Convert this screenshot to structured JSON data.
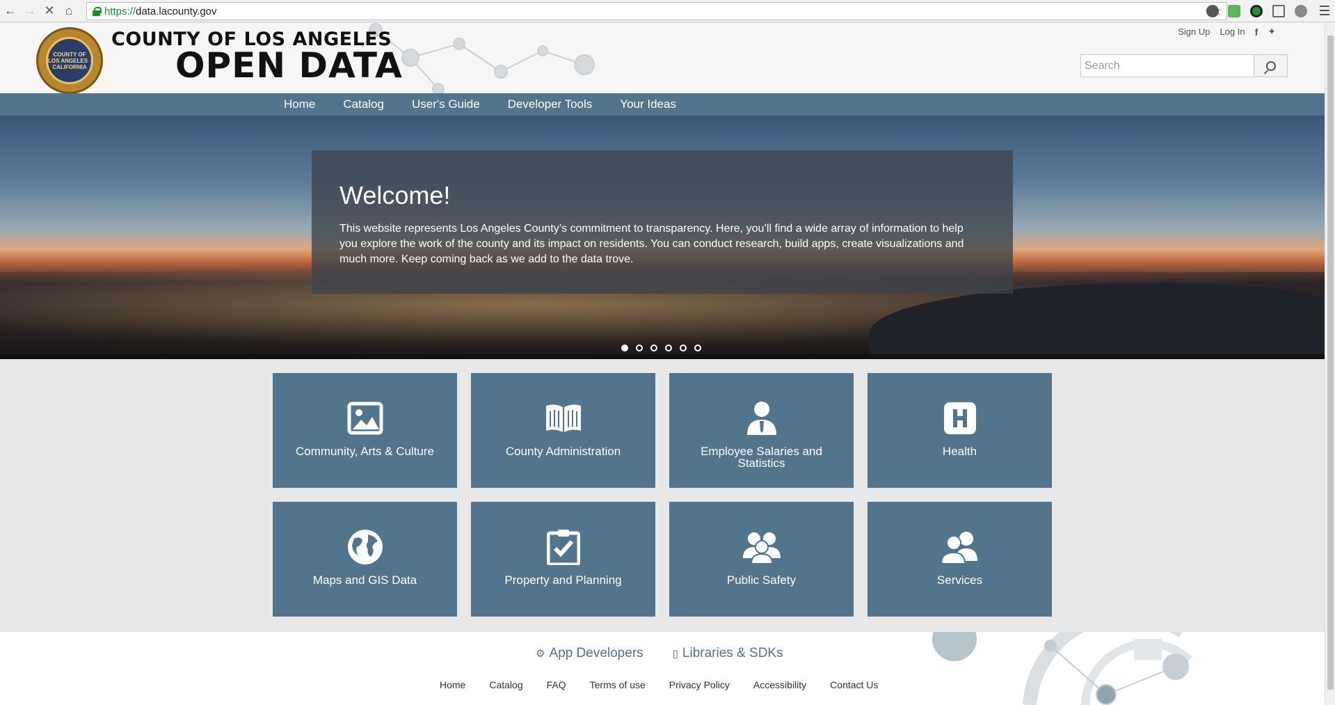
{
  "browser": {
    "url_scheme": "https://",
    "url_host": "data.lacounty.gov"
  },
  "header": {
    "title_top": "COUNTY OF LOS ANGELES",
    "title_bottom": "OPEN DATA",
    "seal_text": "COUNTY OF LOS ANGELES · CALIFORNIA",
    "sign_up": "Sign Up",
    "log_in": "Log In",
    "search_placeholder": "Search"
  },
  "nav": {
    "items": [
      "Home",
      "Catalog",
      "User's Guide",
      "Developer Tools",
      "Your Ideas"
    ]
  },
  "hero": {
    "title": "Welcome!",
    "text": "This website represents Los Angeles County’s commitment to transparency. Here, you’ll find a wide array of information to help you explore the work of the county and its impact on residents. You can conduct research, build apps, create visualizations and much more. Keep coming back as we add to the data trove."
  },
  "tiles": [
    {
      "label": "Community, Arts & Culture",
      "icon": "image-icon"
    },
    {
      "label": "County Administration",
      "icon": "book-icon"
    },
    {
      "label": "Employee Salaries and Statistics",
      "icon": "person-icon"
    },
    {
      "label": "Health",
      "icon": "hospital-icon"
    },
    {
      "label": "Maps and GIS Data",
      "icon": "globe-icon"
    },
    {
      "label": "Property and Planning",
      "icon": "clipboard-check-icon"
    },
    {
      "label": "Public Safety",
      "icon": "group-icon"
    },
    {
      "label": "Services",
      "icon": "users-icon"
    }
  ],
  "footer": {
    "app_developers": "App Developers",
    "libraries": "Libraries & SDKs",
    "links": [
      "Home",
      "Catalog",
      "FAQ",
      "Terms of use",
      "Privacy Policy",
      "Accessibility",
      "Contact Us"
    ]
  },
  "colors": {
    "accent": "#52748c",
    "secure": "#1a8f2e"
  }
}
